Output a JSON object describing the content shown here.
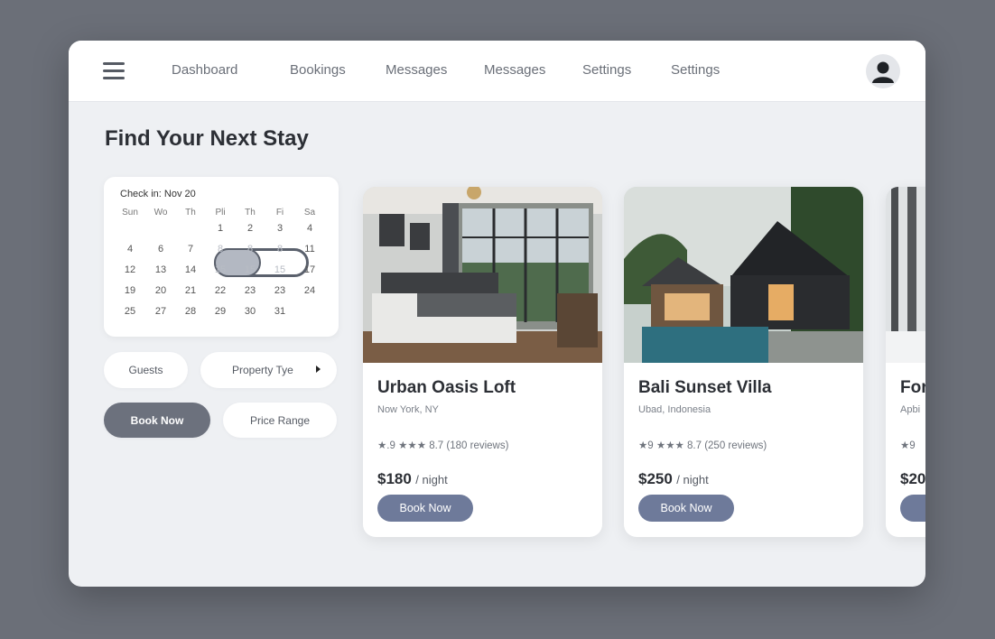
{
  "nav": {
    "items": [
      "Dashboard",
      "Bookings",
      "Messages",
      "Messages",
      "Settings",
      "Settings"
    ]
  },
  "page": {
    "title": "Find Your Next Stay"
  },
  "calendar": {
    "label": "Check in: Nov 20",
    "weekdays": [
      "Sun",
      "Wo",
      "Th",
      "Pli",
      "Th",
      "Fi",
      "Sa"
    ],
    "rows": [
      [
        "",
        "",
        "",
        "1",
        "2",
        "3",
        "4"
      ],
      [
        "4",
        "6",
        "7",
        "8",
        "8",
        "8",
        "11"
      ],
      [
        "12",
        "13",
        "14",
        "15",
        "15",
        "15",
        "17"
      ],
      [
        "19",
        "20",
        "21",
        "22",
        "23",
        "23",
        "24"
      ],
      [
        "25",
        "27",
        "28",
        "29",
        "30",
        "31",
        ""
      ]
    ]
  },
  "filters": {
    "guests": "Guests",
    "property_type": "Property Tye",
    "book_now": "Book Now",
    "price_range": "Price Range"
  },
  "listings": [
    {
      "title": "Urban Oasis Loft",
      "location": "Now York, NY",
      "rating": "★.9 ★★★ 8.7 (180 reviews)",
      "price": "$180",
      "unit": "/ night",
      "button": "Book Now"
    },
    {
      "title": "Bali Sunset Villa",
      "location": "Ubad, Indonesia",
      "rating": "★9 ★★★ 8.7 (250 reviews)",
      "price": "$250",
      "unit": "/ night",
      "button": "Book Now"
    },
    {
      "title": "For",
      "location": "Apbi",
      "rating": "★9",
      "price": "$20",
      "unit": "",
      "button": ""
    }
  ],
  "colors": {
    "accent": "#6e7a9a",
    "primary_pill": "#6c717d",
    "background": "#6b6f78"
  }
}
